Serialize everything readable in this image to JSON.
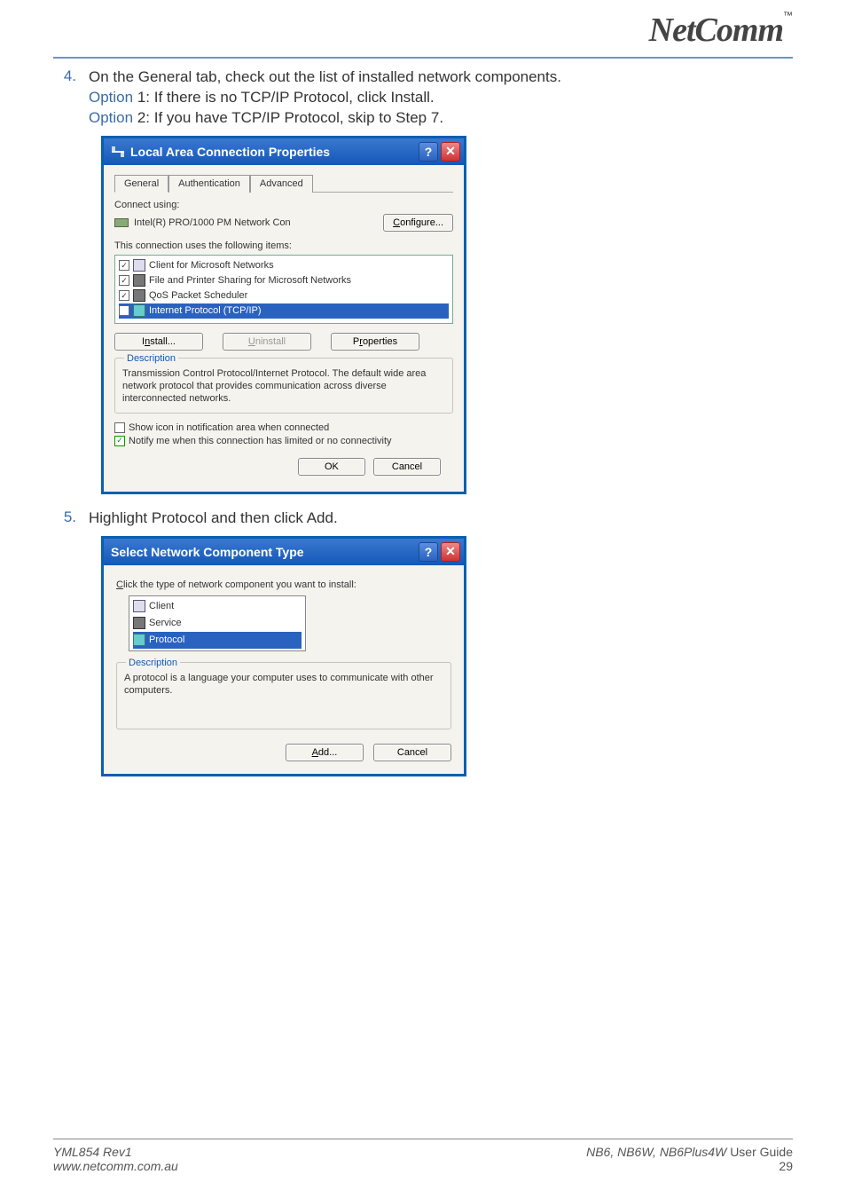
{
  "logo_text": "NetComm",
  "tm": "™",
  "steps": {
    "s4": {
      "num": "4.",
      "text": "On the General tab, check out the list of installed network components.",
      "opt1_label": "Option",
      "opt1_rest": " 1: If there is no TCP/IP Protocol, click Install.",
      "opt2_label": "Option",
      "opt2_rest": " 2: If you have TCP/IP Protocol, skip to Step 7."
    },
    "s5": {
      "num": "5.",
      "text": "Highlight Protocol and then click Add."
    }
  },
  "dialog1": {
    "title": "Local Area Connection Properties",
    "tabs": [
      "General",
      "Authentication",
      "Advanced"
    ],
    "connect_using": "Connect using:",
    "adapter": "Intel(R) PRO/1000 PM Network Con",
    "configure": "Configure...",
    "uses_label": "This connection uses the following items:",
    "items": [
      {
        "label": "Client for Microsoft Networks",
        "checked": true,
        "icon": "mon",
        "selected": false
      },
      {
        "label": "File and Printer Sharing for Microsoft Networks",
        "checked": true,
        "icon": "srv",
        "selected": false
      },
      {
        "label": "QoS Packet Scheduler",
        "checked": true,
        "icon": "srv",
        "selected": false
      },
      {
        "label": "Internet Protocol (TCP/IP)",
        "checked": true,
        "icon": "proto",
        "selected": true
      }
    ],
    "install": "Install...",
    "uninstall": "Uninstall",
    "properties": "Properties",
    "desc_legend": "Description",
    "desc_text": "Transmission Control Protocol/Internet Protocol. The default wide area network protocol that provides communication across diverse interconnected networks.",
    "show_icon": "Show icon in notification area when connected",
    "show_icon_checked": false,
    "notify": "Notify me when this connection has limited or no connectivity",
    "notify_checked": true,
    "ok": "OK",
    "cancel": "Cancel"
  },
  "dialog2": {
    "title": "Select Network Component Type",
    "prompt": "Click the type of network component you want to install:",
    "items": [
      {
        "label": "Client",
        "icon": "mon",
        "selected": false
      },
      {
        "label": "Service",
        "icon": "srv",
        "selected": false
      },
      {
        "label": "Protocol",
        "icon": "proto",
        "selected": true
      }
    ],
    "desc_legend": "Description",
    "desc_text": "A protocol is a language your computer uses to communicate with other computers.",
    "add": "Add...",
    "cancel": "Cancel"
  },
  "footer": {
    "left1": "YML854 Rev1",
    "left2": "www.netcomm.com.au",
    "right1_em": "NB6, NB6W, NB6Plus4W ",
    "right1_rest": "User Guide",
    "page": "29"
  }
}
